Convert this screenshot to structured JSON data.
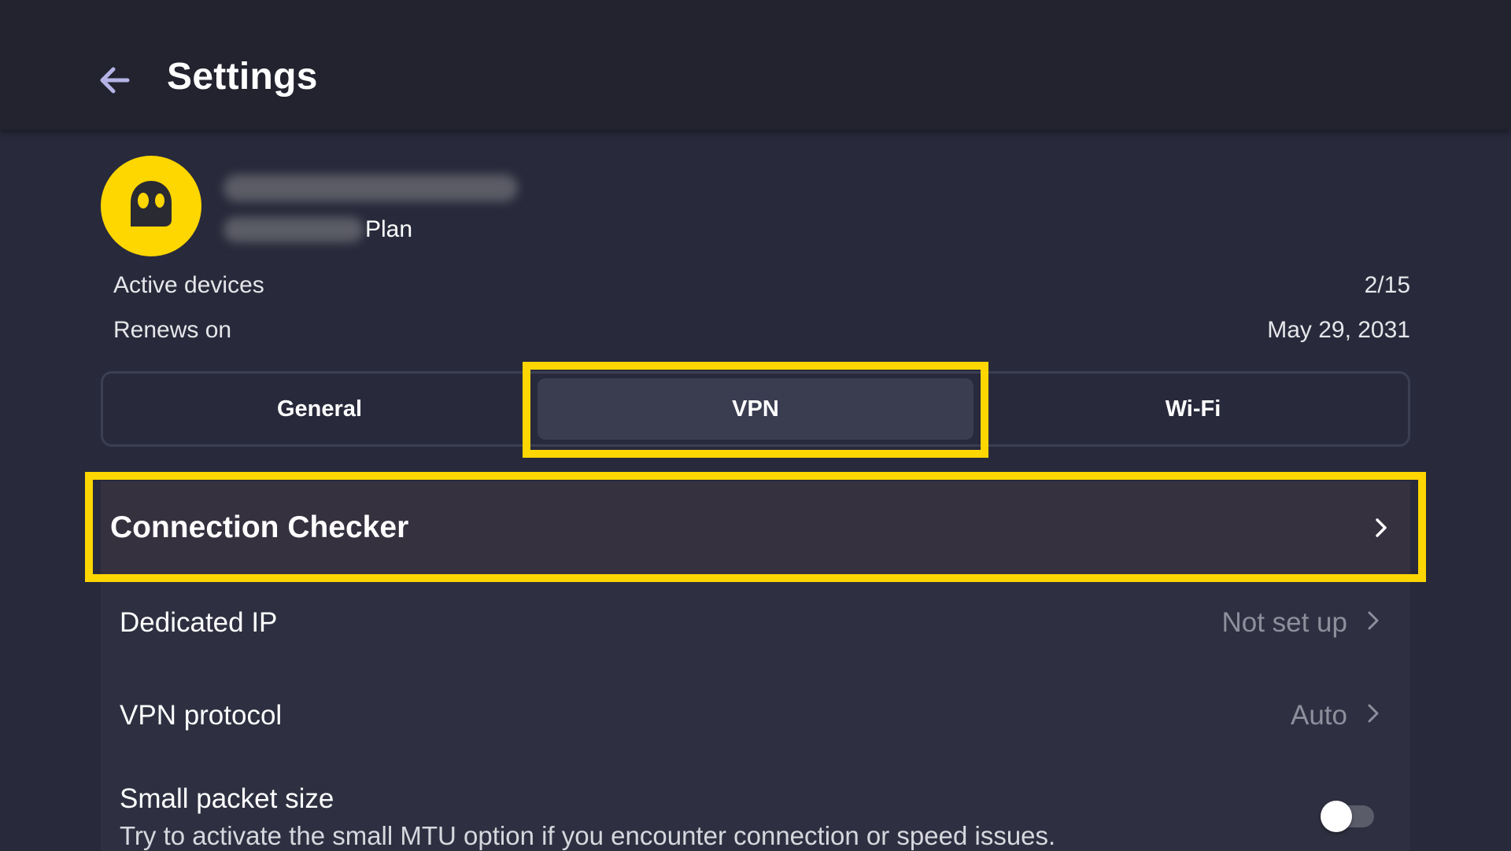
{
  "header": {
    "title": "Settings",
    "back_icon": "arrow-left-icon"
  },
  "account": {
    "avatar_icon": "ghost-logo-icon",
    "plan_suffix": "Plan",
    "active_devices_label": "Active devices",
    "active_devices_value": "2/15",
    "renews_label": "Renews on",
    "renews_value": "May 29, 2031"
  },
  "tabs": [
    {
      "label": "General",
      "selected": false
    },
    {
      "label": "VPN",
      "selected": true
    },
    {
      "label": "Wi-Fi",
      "selected": false
    }
  ],
  "vpn_settings": {
    "connection_checker": {
      "label": "Connection Checker"
    },
    "dedicated_ip": {
      "label": "Dedicated IP",
      "value": "Not set up"
    },
    "vpn_protocol": {
      "label": "VPN protocol",
      "value": "Auto"
    },
    "small_packet": {
      "label": "Small packet size",
      "description": "Try to activate the small MTU option if you encounter connection or speed issues.",
      "enabled": false
    }
  },
  "colors": {
    "accent": "#fed600",
    "background": "#282a3b",
    "topbar": "#22232f"
  }
}
